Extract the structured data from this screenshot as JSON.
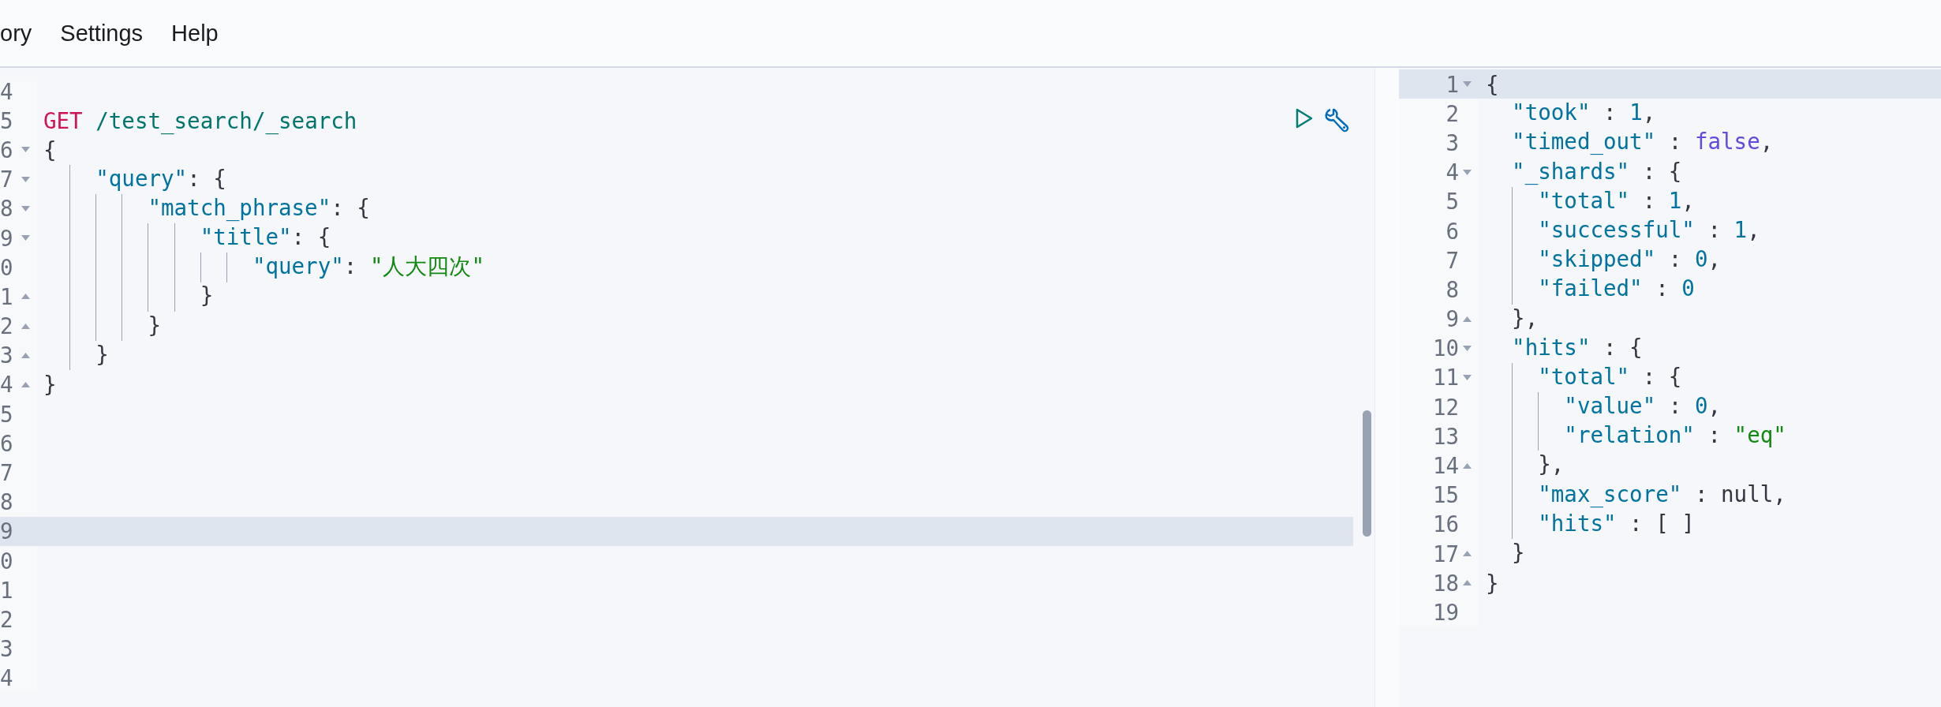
{
  "menu": [
    {
      "label": "ory"
    },
    {
      "label": "Settings"
    },
    {
      "label": "Help"
    }
  ],
  "request_editor": {
    "lines": [
      {
        "num": "4",
        "active": false,
        "kind": "plain"
      },
      {
        "num": "5",
        "active": false,
        "kind": "request",
        "tokens": [
          {
            "kind": "method",
            "text": "GET"
          },
          {
            "kind": "url",
            "text": " /test_search/_search"
          }
        ]
      },
      {
        "num": "6",
        "active": false,
        "kind": "fold-start",
        "tokens": [
          {
            "kind": "punct",
            "text": "{"
          }
        ]
      },
      {
        "num": "7",
        "active": false,
        "kind": "fold-start",
        "tokens": [
          {
            "kind": "key",
            "text": "    \"query\""
          },
          {
            "kind": "punct",
            "text": ": {"
          }
        ]
      },
      {
        "num": "8",
        "active": false,
        "kind": "fold-start",
        "tokens": [
          {
            "kind": "key",
            "text": "        \"match_phrase\""
          },
          {
            "kind": "punct",
            "text": ": {"
          }
        ]
      },
      {
        "num": "9",
        "active": false,
        "kind": "fold-start",
        "tokens": [
          {
            "kind": "key",
            "text": "            \"title\""
          },
          {
            "kind": "punct",
            "text": ": {"
          }
        ]
      },
      {
        "num": "0",
        "active": false,
        "kind": "plain",
        "tokens": [
          {
            "kind": "key",
            "text": "                \"query\""
          },
          {
            "kind": "punct",
            "text": ": "
          },
          {
            "kind": "string",
            "text": "\"人大四次\""
          }
        ]
      },
      {
        "num": "1",
        "active": false,
        "kind": "fold-end",
        "tokens": [
          {
            "kind": "punct",
            "text": "            }"
          }
        ]
      },
      {
        "num": "2",
        "active": false,
        "kind": "fold-end",
        "tokens": [
          {
            "kind": "punct",
            "text": "        }"
          }
        ]
      },
      {
        "num": "3",
        "active": false,
        "kind": "fold-end",
        "tokens": [
          {
            "kind": "punct",
            "text": "    }"
          }
        ]
      },
      {
        "num": "4",
        "active": false,
        "kind": "fold-end",
        "tokens": [
          {
            "kind": "punct",
            "text": "}"
          }
        ]
      },
      {
        "num": "5",
        "active": false,
        "kind": "plain"
      },
      {
        "num": "6",
        "active": false,
        "kind": "plain"
      },
      {
        "num": "7",
        "active": false,
        "kind": "plain"
      },
      {
        "num": "8",
        "active": false,
        "kind": "plain"
      },
      {
        "num": "9",
        "active": true,
        "kind": "plain"
      },
      {
        "num": "0",
        "active": false,
        "kind": "plain"
      },
      {
        "num": "1",
        "active": false,
        "kind": "plain"
      },
      {
        "num": "2",
        "active": false,
        "kind": "plain"
      },
      {
        "num": "3",
        "active": false,
        "kind": "plain"
      },
      {
        "num": "4",
        "active": false,
        "kind": "plain"
      }
    ]
  },
  "response_viewer": {
    "lines": [
      {
        "num": "1",
        "active": true,
        "kind": "fold-start",
        "tokens": [
          {
            "kind": "punct",
            "text": "{"
          }
        ]
      },
      {
        "num": "2",
        "active": false,
        "kind": "plain",
        "tokens": [
          {
            "kind": "key",
            "text": "  \"took\""
          },
          {
            "kind": "punct",
            "text": " : "
          },
          {
            "kind": "number",
            "text": "1"
          },
          {
            "kind": "punct",
            "text": ","
          }
        ]
      },
      {
        "num": "3",
        "active": false,
        "kind": "plain",
        "tokens": [
          {
            "kind": "key",
            "text": "  \"timed_out\""
          },
          {
            "kind": "punct",
            "text": " : "
          },
          {
            "kind": "boolean",
            "text": "false"
          },
          {
            "kind": "punct",
            "text": ","
          }
        ]
      },
      {
        "num": "4",
        "active": false,
        "kind": "fold-start",
        "tokens": [
          {
            "kind": "key",
            "text": "  \"_shards\""
          },
          {
            "kind": "punct",
            "text": " : {"
          }
        ]
      },
      {
        "num": "5",
        "active": false,
        "kind": "plain",
        "tokens": [
          {
            "kind": "key",
            "text": "    \"total\""
          },
          {
            "kind": "punct",
            "text": " : "
          },
          {
            "kind": "number",
            "text": "1"
          },
          {
            "kind": "punct",
            "text": ","
          }
        ]
      },
      {
        "num": "6",
        "active": false,
        "kind": "plain",
        "tokens": [
          {
            "kind": "key",
            "text": "    \"successful\""
          },
          {
            "kind": "punct",
            "text": " : "
          },
          {
            "kind": "number",
            "text": "1"
          },
          {
            "kind": "punct",
            "text": ","
          }
        ]
      },
      {
        "num": "7",
        "active": false,
        "kind": "plain",
        "tokens": [
          {
            "kind": "key",
            "text": "    \"skipped\""
          },
          {
            "kind": "punct",
            "text": " : "
          },
          {
            "kind": "number",
            "text": "0"
          },
          {
            "kind": "punct",
            "text": ","
          }
        ]
      },
      {
        "num": "8",
        "active": false,
        "kind": "plain",
        "tokens": [
          {
            "kind": "key",
            "text": "    \"failed\""
          },
          {
            "kind": "punct",
            "text": " : "
          },
          {
            "kind": "number",
            "text": "0"
          }
        ]
      },
      {
        "num": "9",
        "active": false,
        "kind": "fold-end",
        "tokens": [
          {
            "kind": "punct",
            "text": "  },"
          }
        ]
      },
      {
        "num": "10",
        "active": false,
        "kind": "fold-start",
        "tokens": [
          {
            "kind": "key",
            "text": "  \"hits\""
          },
          {
            "kind": "punct",
            "text": " : {"
          }
        ]
      },
      {
        "num": "11",
        "active": false,
        "kind": "fold-start",
        "tokens": [
          {
            "kind": "key",
            "text": "    \"total\""
          },
          {
            "kind": "punct",
            "text": " : {"
          }
        ]
      },
      {
        "num": "12",
        "active": false,
        "kind": "plain",
        "tokens": [
          {
            "kind": "key",
            "text": "      \"value\""
          },
          {
            "kind": "punct",
            "text": " : "
          },
          {
            "kind": "number",
            "text": "0"
          },
          {
            "kind": "punct",
            "text": ","
          }
        ]
      },
      {
        "num": "13",
        "active": false,
        "kind": "plain",
        "tokens": [
          {
            "kind": "key",
            "text": "      \"relation\""
          },
          {
            "kind": "punct",
            "text": " : "
          },
          {
            "kind": "string",
            "text": "\"eq\""
          }
        ]
      },
      {
        "num": "14",
        "active": false,
        "kind": "fold-end",
        "tokens": [
          {
            "kind": "punct",
            "text": "    },"
          }
        ]
      },
      {
        "num": "15",
        "active": false,
        "kind": "plain",
        "tokens": [
          {
            "kind": "key",
            "text": "    \"max_score\""
          },
          {
            "kind": "punct",
            "text": " : "
          },
          {
            "kind": "null",
            "text": "null"
          },
          {
            "kind": "punct",
            "text": ","
          }
        ]
      },
      {
        "num": "16",
        "active": false,
        "kind": "plain",
        "tokens": [
          {
            "kind": "key",
            "text": "    \"hits\""
          },
          {
            "kind": "punct",
            "text": " : [ ]"
          }
        ]
      },
      {
        "num": "17",
        "active": false,
        "kind": "fold-end",
        "tokens": [
          {
            "kind": "punct",
            "text": "  }"
          }
        ]
      },
      {
        "num": "18",
        "active": false,
        "kind": "fold-end",
        "tokens": [
          {
            "kind": "punct",
            "text": "}"
          }
        ]
      },
      {
        "num": "19",
        "active": false,
        "kind": "plain"
      }
    ]
  }
}
